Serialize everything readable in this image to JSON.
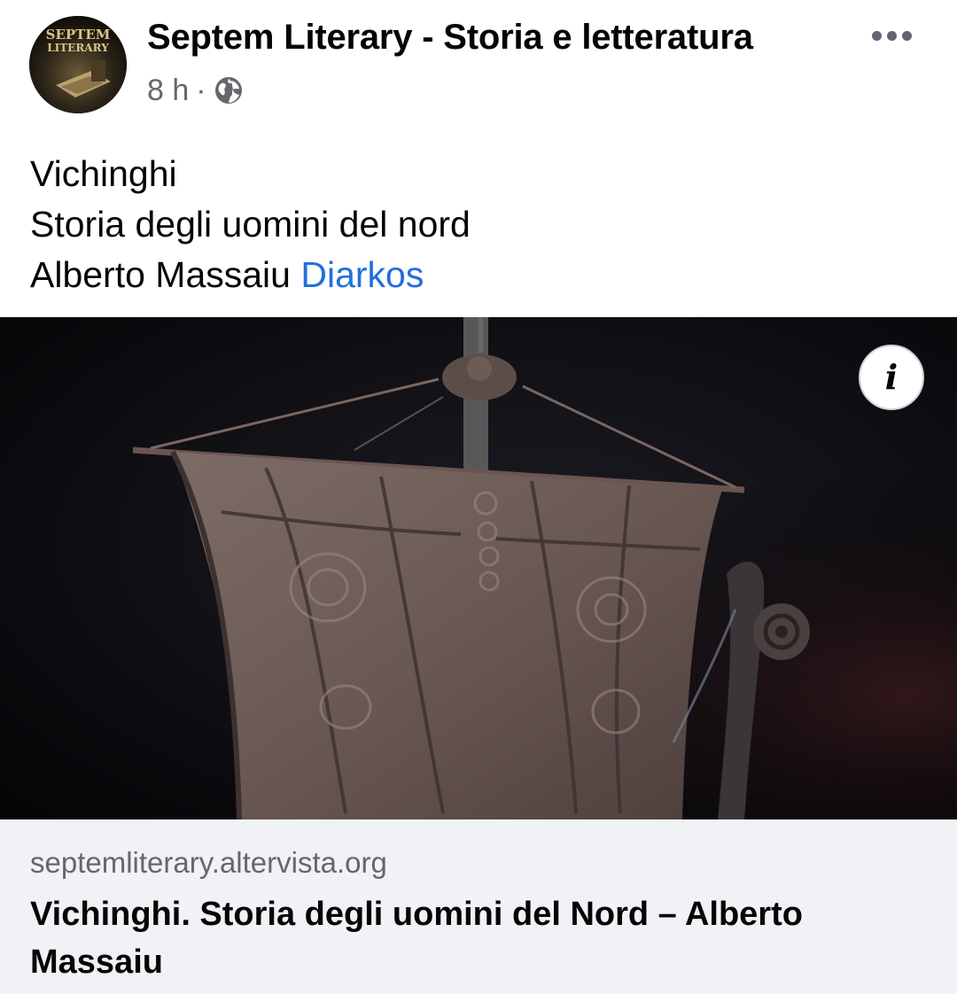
{
  "post": {
    "author": "Septem Literary - Storia e letteratura",
    "avatar_text": [
      "SEPTEM",
      "LITERARY"
    ],
    "time": "8 h",
    "separator": "·",
    "audience_icon": "globe-icon",
    "more_icon": "more-horizontal-icon",
    "text_lines": [
      "Vichinghi",
      "Storia degli uomini del nord",
      "Alberto Massaiu"
    ],
    "publisher": "Diarkos",
    "info_icon_label": "i"
  },
  "link_preview": {
    "domain": "septemliterary.altervista.org",
    "title": "Vichinghi. Storia degli uomini del Nord – Alberto Massaiu"
  },
  "colors": {
    "link_blue": "#216fdb",
    "secondary_text": "#65676b",
    "preview_background": "#f0f2f5"
  }
}
